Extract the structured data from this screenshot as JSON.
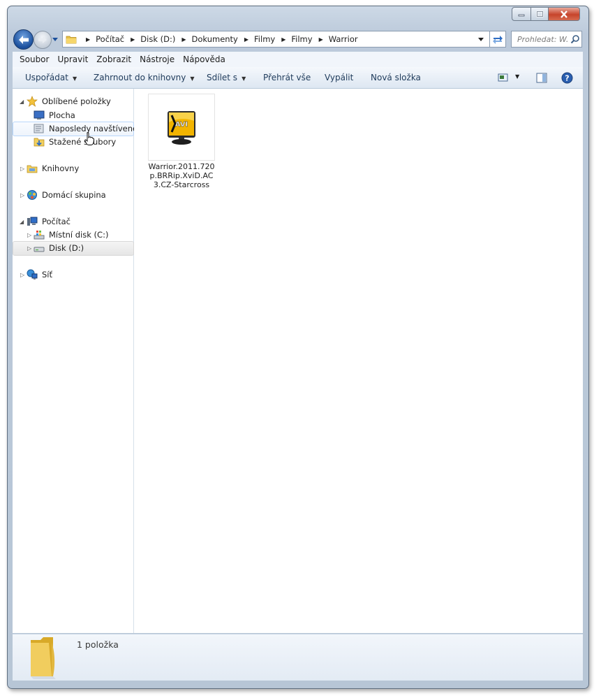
{
  "window": {
    "controls": {
      "minimize": "minimize",
      "maximize": "maximize",
      "close": "close"
    }
  },
  "address_bar": {
    "breadcrumbs": [
      "Počítač",
      "Disk (D:)",
      "Dokumenty",
      "Filmy",
      "Filmy",
      "Warrior"
    ]
  },
  "search": {
    "placeholder": "Prohledat: W..."
  },
  "menu": [
    "Soubor",
    "Upravit",
    "Zobrazit",
    "Nástroje",
    "Nápověda"
  ],
  "toolbar": {
    "organize": "Uspořádat",
    "include_library": "Zahrnout do knihovny",
    "share": "Sdílet s",
    "play_all": "Přehrát vše",
    "burn": "Vypálit",
    "new_folder": "Nová složka"
  },
  "nav": {
    "favorites": {
      "label": "Oblíbené položky",
      "items": [
        "Plocha",
        "Naposledy navštívené",
        "Stažené soubory"
      ]
    },
    "libraries": "Knihovny",
    "homegroup": "Domácí skupina",
    "computer": {
      "label": "Počítač",
      "items": [
        "Místní disk (C:)",
        "Disk (D:)"
      ]
    },
    "network": "Síť"
  },
  "files": [
    {
      "name": "Warrior.2011.720p.BRRip.XviD.AC3.CZ-Starcross",
      "badge": "AVI"
    }
  ],
  "status": {
    "item_count": "1 položka"
  },
  "colors": {
    "avi_badge": "#f2b400",
    "close_button": "#c7442b",
    "accent": "#1b4f9c"
  }
}
